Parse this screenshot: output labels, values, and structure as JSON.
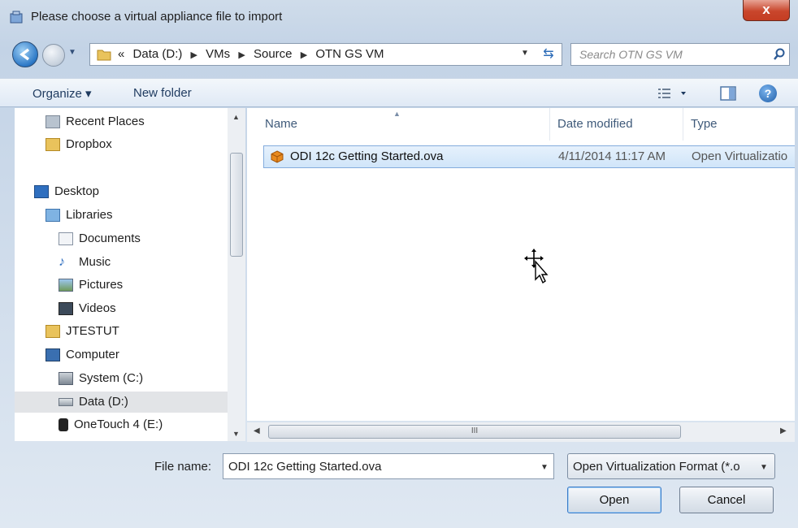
{
  "window": {
    "title": "Please choose a virtual appliance file to import",
    "close_label": "x"
  },
  "address": {
    "crumbs": [
      "«",
      "Data (D:)",
      "VMs",
      "Source",
      "OTN GS VM"
    ]
  },
  "search": {
    "placeholder": "Search OTN GS VM"
  },
  "toolbar": {
    "organize_label": "Organize ▾",
    "new_folder_label": "New folder",
    "help_label": "?"
  },
  "nav_pane": {
    "items": [
      {
        "label": "Recent Places",
        "icon": "recent-places-icon"
      },
      {
        "label": "Dropbox",
        "icon": "folder-icon"
      },
      {
        "label": "Desktop",
        "icon": "desktop-icon"
      },
      {
        "label": "Libraries",
        "icon": "libraries-icon"
      },
      {
        "label": "Documents",
        "icon": "documents-icon"
      },
      {
        "label": "Music",
        "icon": "music-icon"
      },
      {
        "label": "Pictures",
        "icon": "pictures-icon"
      },
      {
        "label": "Videos",
        "icon": "videos-icon"
      },
      {
        "label": "JTESTUT",
        "icon": "user-folder-icon"
      },
      {
        "label": "Computer",
        "icon": "computer-icon"
      },
      {
        "label": "System (C:)",
        "icon": "system-drive-icon"
      },
      {
        "label": "Data (D:)",
        "icon": "drive-icon"
      },
      {
        "label": "OneTouch 4 (E:)",
        "icon": "external-drive-icon"
      }
    ],
    "selected": "Data (D:)"
  },
  "file_list": {
    "columns": [
      "Name",
      "Date modified",
      "Type"
    ],
    "rows": [
      {
        "name": "ODI 12c Getting Started.ova",
        "date_modified": "4/11/2014 11:17 AM",
        "type": "Open Virtualizatio"
      }
    ],
    "scroll_grip": "III"
  },
  "footer": {
    "file_name_label": "File name:",
    "file_name_value": "ODI 12c Getting Started.ova",
    "filter_value": "Open Virtualization Format (*.o",
    "open_label": "Open",
    "cancel_label": "Cancel"
  },
  "colors": {
    "accent": "#3a7bc8",
    "selection": "#d0e5f9",
    "close": "#c9462c"
  }
}
